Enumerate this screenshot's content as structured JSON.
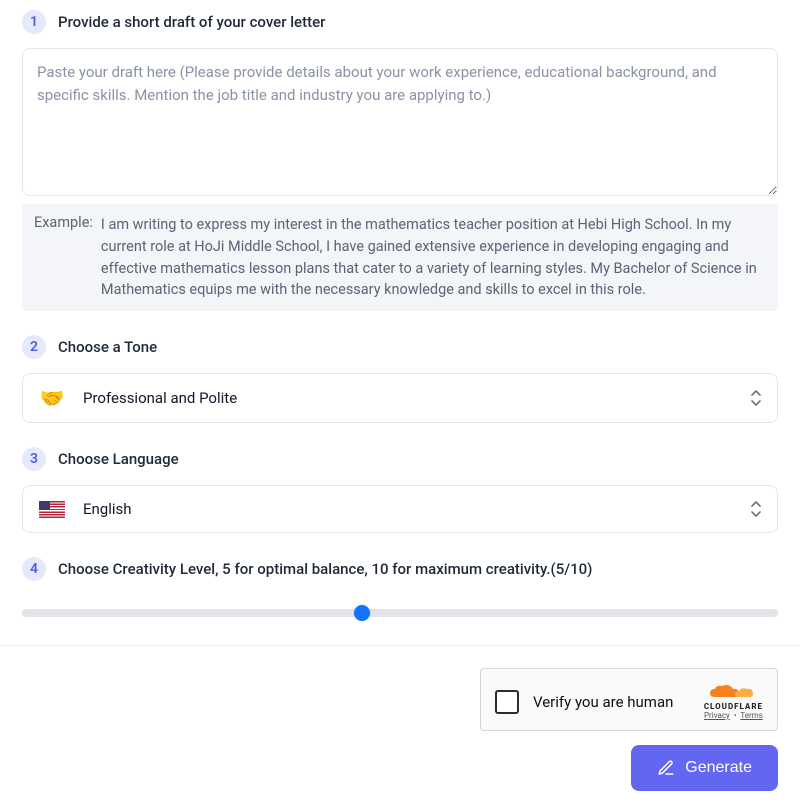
{
  "step1": {
    "num": "1",
    "title": "Provide a short draft of your cover letter",
    "placeholder": "Paste your draft here (Please provide details about your work experience, educational background, and specific skills. Mention the job title and industry you are applying to.)",
    "example_label": "Example:",
    "example_text": "I am writing to express my interest in the mathematics teacher position at Hebi High School. In my current role at HoJi Middle School, I have gained extensive experience in developing engaging and effective mathematics lesson plans that cater to a variety of learning styles. My Bachelor of Science in Mathematics equips me with the necessary knowledge and skills to excel in this role."
  },
  "step2": {
    "num": "2",
    "title": "Choose a Tone",
    "icon": "🤝",
    "value": "Professional and Polite"
  },
  "step3": {
    "num": "3",
    "title": "Choose Language",
    "value": "English"
  },
  "step4": {
    "num": "4",
    "title": "Choose Creativity Level, 5 for optimal balance, 10 for maximum creativity.(5/10)",
    "value": 5,
    "min": 0,
    "max": 10
  },
  "captcha": {
    "label": "Verify you are human",
    "brand": "CLOUDFLARE",
    "privacy": "Privacy",
    "terms": "Terms"
  },
  "generate_label": "Generate"
}
